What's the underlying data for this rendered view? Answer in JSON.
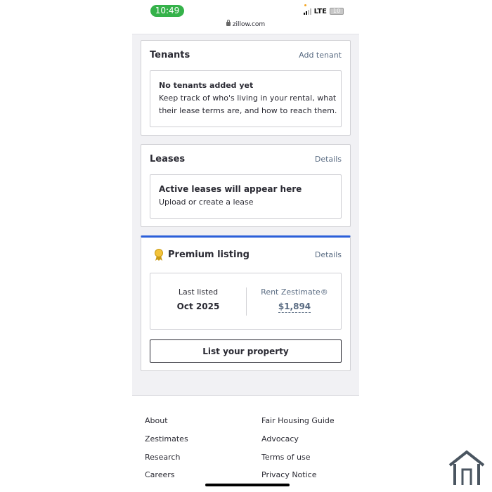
{
  "status_bar": {
    "time": "10:49",
    "network": "LTE",
    "battery": "10"
  },
  "browser": {
    "url": "zillow.com"
  },
  "tenants": {
    "title": "Tenants",
    "action": "Add tenant",
    "empty_title": "No tenants added yet",
    "empty_line1": "Keep track of who's living in your rental, what",
    "empty_line2": "their lease terms are, and how to reach them."
  },
  "leases": {
    "title": "Leases",
    "action": "Details",
    "empty_title": "Active leases will appear here",
    "empty_subtitle": "Upload or create a lease"
  },
  "premium": {
    "title": "Premium listing",
    "action": "Details",
    "last_listed_label": "Last listed",
    "last_listed_value": "Oct 2025",
    "zestimate_label": "Rent Zestimate®",
    "zestimate_value": "$1,894",
    "button": "List your property",
    "accent_color": "#2b5fd9"
  },
  "footer": {
    "col1": [
      "About",
      "Zestimates",
      "Research",
      "Careers"
    ],
    "col2": [
      "Fair Housing Guide",
      "Advocacy",
      "Terms of use",
      "Privacy Notice"
    ]
  }
}
